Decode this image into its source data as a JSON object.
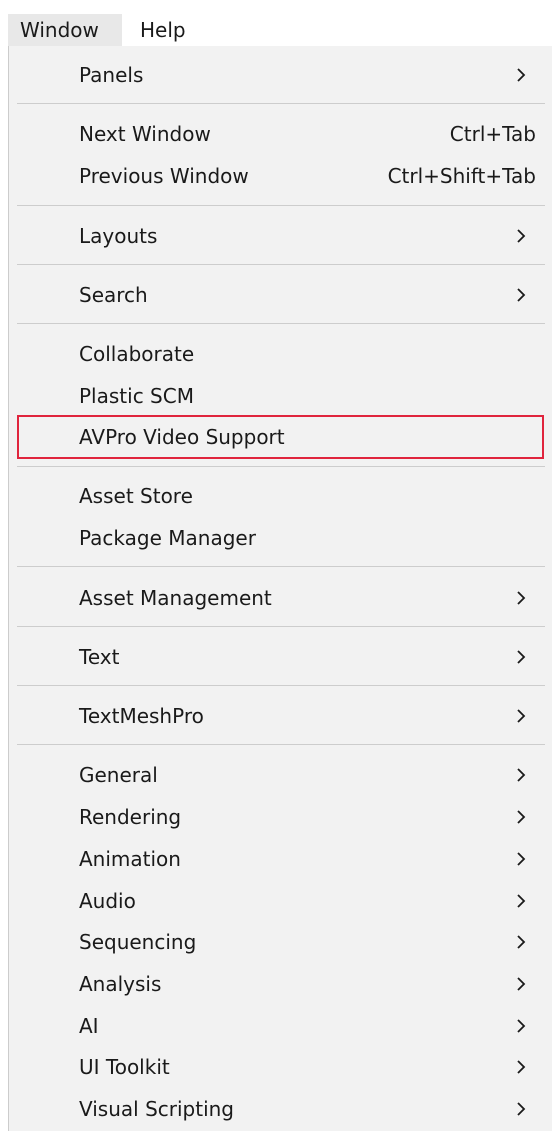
{
  "menubar": {
    "window": "Window",
    "help": "Help"
  },
  "menu": {
    "items": [
      {
        "label": "Panels",
        "submenu": true
      },
      {
        "label": "Next Window",
        "shortcut": "Ctrl+Tab"
      },
      {
        "label": "Previous Window",
        "shortcut": "Ctrl+Shift+Tab"
      },
      {
        "label": "Layouts",
        "submenu": true
      },
      {
        "label": "Search",
        "submenu": true
      },
      {
        "label": "Collaborate"
      },
      {
        "label": "Plastic SCM"
      },
      {
        "label": "AVPro Video Support",
        "highlighted": true
      },
      {
        "label": "Asset Store"
      },
      {
        "label": "Package Manager"
      },
      {
        "label": "Asset Management",
        "submenu": true
      },
      {
        "label": "Text",
        "submenu": true
      },
      {
        "label": "TextMeshPro",
        "submenu": true
      },
      {
        "label": "General",
        "submenu": true
      },
      {
        "label": "Rendering",
        "submenu": true
      },
      {
        "label": "Animation",
        "submenu": true
      },
      {
        "label": "Audio",
        "submenu": true
      },
      {
        "label": "Sequencing",
        "submenu": true
      },
      {
        "label": "Analysis",
        "submenu": true
      },
      {
        "label": "AI",
        "submenu": true
      },
      {
        "label": "UI Toolkit",
        "submenu": true
      },
      {
        "label": "Visual Scripting",
        "submenu": true
      }
    ]
  },
  "colors": {
    "highlight_border": "#e0243d",
    "menu_background": "#f2f2f2",
    "separator": "#cdcdcd"
  },
  "icons": {
    "submenu": "chevron-right-icon"
  }
}
